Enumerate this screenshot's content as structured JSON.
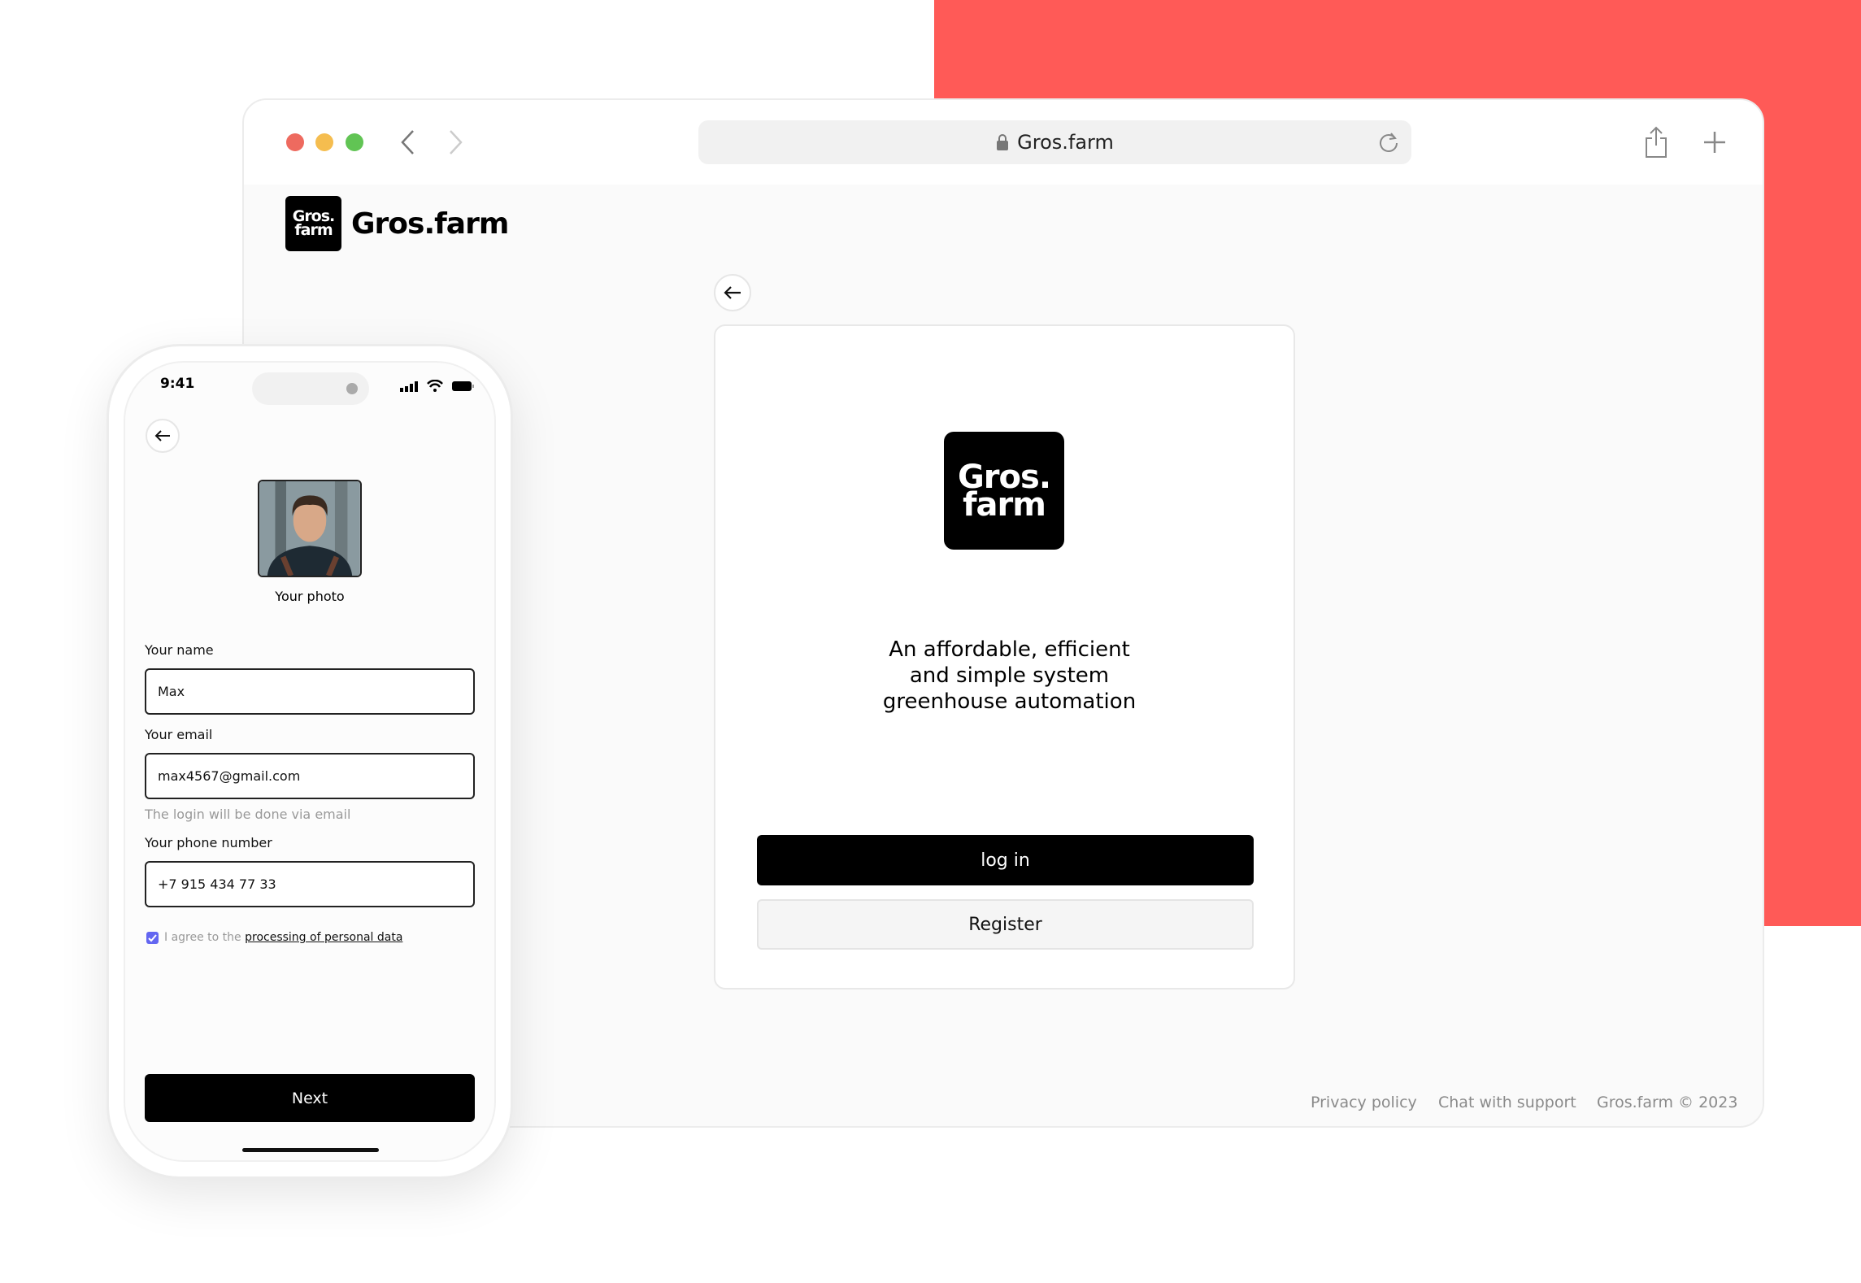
{
  "colors": {
    "accent": "#ff5a57",
    "close": "#ee6a5f",
    "minimize": "#f5bd4f",
    "maximize": "#61c454",
    "checkbox": "#6366f1"
  },
  "browser": {
    "url": "Gros.farm",
    "icons": [
      "lock-icon",
      "reload-icon",
      "share-icon",
      "plus-icon",
      "chevron-left-icon",
      "chevron-right-icon"
    ]
  },
  "site": {
    "logo_line1": "Gros.",
    "logo_line2": "farm",
    "brand": "Gros.farm",
    "tagline": [
      "An affordable, efficient",
      "and simple system",
      "greenhouse automation"
    ],
    "login_label": "log in",
    "register_label": "Register",
    "footer": {
      "privacy": "Privacy policy",
      "support": "Chat with support",
      "copyright": "Gros.farm © 2023"
    }
  },
  "phone": {
    "time": "9:41",
    "photo_label": "Your photo",
    "name_label": "Your name",
    "name_value": "Max",
    "email_label": "Your email",
    "email_value": "max4567@gmail.com",
    "email_hint": "The login will be done via email",
    "phone_label": "Your phone number",
    "phone_value": "+7 915 434 77 33",
    "consent_prefix": "I agree to the ",
    "consent_link": "processing of personal data",
    "consent_checked": true,
    "next_label": "Next"
  }
}
